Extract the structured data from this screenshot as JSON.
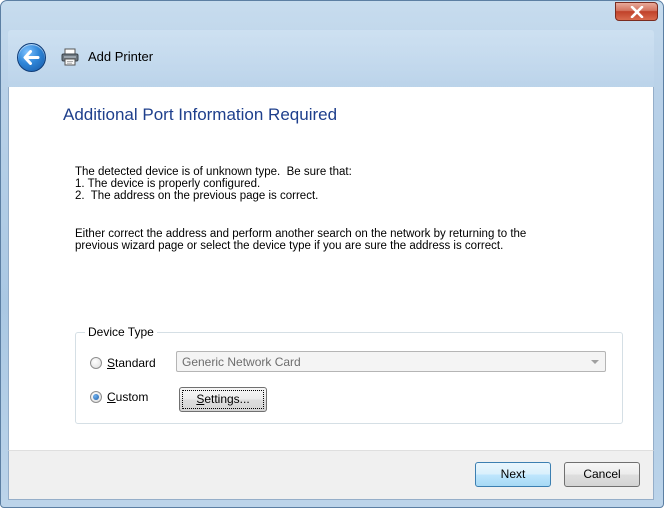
{
  "window": {
    "title": "Add Printer",
    "close_icon": "close-icon"
  },
  "nav": {
    "back_icon": "back-arrow-icon",
    "printer_icon": "printer-icon"
  },
  "main": {
    "heading": "Additional Port Information Required",
    "paragraph1": [
      "The detected device is of unknown type.  Be sure that:",
      "1. The device is properly configured.",
      "2.  The address on the previous page is correct."
    ],
    "paragraph2": [
      "Either correct the address and perform another search on the network by returning to the",
      "previous wizard page or select the device type if you are sure the address is correct."
    ]
  },
  "device_type": {
    "legend": "Device Type",
    "standard": {
      "label_accel": "S",
      "label_rest": "tandard",
      "selected": false,
      "combo_value": "Generic Network Card",
      "enabled": false
    },
    "custom": {
      "label_accel": "C",
      "label_rest": "ustom",
      "selected": true
    },
    "settings_button": {
      "label_accel": "S",
      "label_rest": "ettings..."
    }
  },
  "footer": {
    "next_label": "Next",
    "cancel_label": "Cancel"
  },
  "colors": {
    "heading": "#1e3f8c",
    "frame": "#aac8e3",
    "close": "#c0412a"
  }
}
